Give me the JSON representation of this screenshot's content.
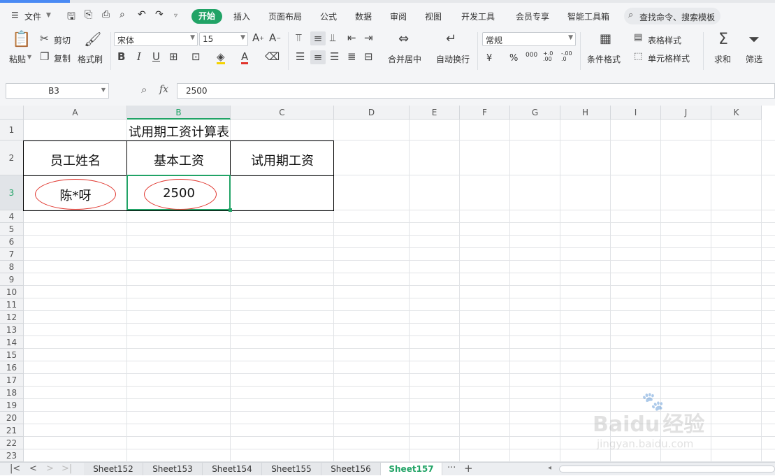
{
  "menu": {
    "file": "文件",
    "tabs": [
      "开始",
      "插入",
      "页面布局",
      "公式",
      "数据",
      "审阅",
      "视图",
      "开发工具",
      "会员专享",
      "智能工具箱"
    ],
    "search_placeholder": "查找命令、搜索模板"
  },
  "ribbon": {
    "paste": "粘贴",
    "cut": "剪切",
    "copy": "复制",
    "format_painter": "格式刷",
    "font_name": "宋体",
    "font_size": "15",
    "merge_center": "合并居中",
    "wrap_text": "自动换行",
    "number_format": "常规",
    "conditional_format": "条件格式",
    "table_style": "表格样式",
    "cell_style": "单元格样式",
    "sum": "求和",
    "filter": "筛选",
    "currency": "¥",
    "percent": "%",
    "thousands": "000",
    "inc_decimal": "+.0 .00",
    "dec_decimal": "-.00 .0"
  },
  "formula_bar": {
    "name_box": "B3",
    "fx": "fx",
    "value": "2500"
  },
  "columns": [
    "A",
    "B",
    "C",
    "D",
    "E",
    "F",
    "G",
    "H",
    "I",
    "J",
    "K"
  ],
  "rows": [
    "1",
    "2",
    "3",
    "4",
    "5",
    "6",
    "7",
    "8",
    "9",
    "10",
    "11",
    "12",
    "13",
    "14",
    "15",
    "16",
    "17",
    "18",
    "19",
    "20",
    "21",
    "22",
    "23"
  ],
  "sheet": {
    "title": "试用期工资计算表",
    "headers": [
      "员工姓名",
      "基本工资",
      "试用期工资"
    ],
    "row3": [
      "陈*呀",
      "2500",
      ""
    ]
  },
  "sheet_tabs": [
    "Sheet152",
    "Sheet153",
    "Sheet154",
    "Sheet155",
    "Sheet156",
    "Sheet157"
  ],
  "active_sheet": "Sheet157",
  "watermark": {
    "brand": "Baidu",
    "product": "经验",
    "url": "jingyan.baidu.com"
  },
  "colors": {
    "accent": "#21a366",
    "annotation": "#e0342c",
    "topline": "#4a8af4"
  }
}
